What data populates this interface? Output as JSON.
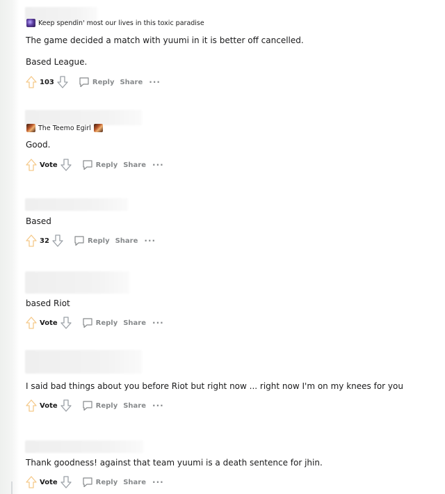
{
  "comments": [
    {
      "flair": "Keep spendin' most our lives in this toxic paradise",
      "flair_icon": "purple-flair-icon",
      "paragraphs": [
        "The game decided a match with yuumi in it is better off cancelled.",
        "Based League."
      ],
      "score": "103",
      "reply": "Reply",
      "share": "Share",
      "more": "···"
    },
    {
      "flair": "The Teemo Egirl",
      "flair_icon": "teemo-flair-icon",
      "paragraphs": [
        "Good."
      ],
      "score": "Vote",
      "reply": "Reply",
      "share": "Share",
      "more": "···"
    },
    {
      "flair": "",
      "paragraphs": [
        "Based"
      ],
      "score": "32",
      "reply": "Reply",
      "share": "Share",
      "more": "···"
    },
    {
      "flair": "",
      "paragraphs": [
        "based Riot"
      ],
      "score": "Vote",
      "reply": "Reply",
      "share": "Share",
      "more": "···"
    },
    {
      "flair": "",
      "paragraphs": [
        "I said bad things about you before Riot but right now ... right now I'm on my knees for you"
      ],
      "score": "Vote",
      "reply": "Reply",
      "share": "Share",
      "more": "···"
    },
    {
      "flair": "",
      "paragraphs": [
        "Thank goodness! against that team yuumi is a death sentence for jhin."
      ],
      "score": "Vote",
      "reply": "Reply",
      "share": "Share",
      "more": "···"
    }
  ],
  "colors": {
    "action_gray": "#878a8c",
    "text": "#1a1a1b",
    "upvote_outline": "#f5c98a",
    "downvote_outline": "#9aa0a6"
  }
}
